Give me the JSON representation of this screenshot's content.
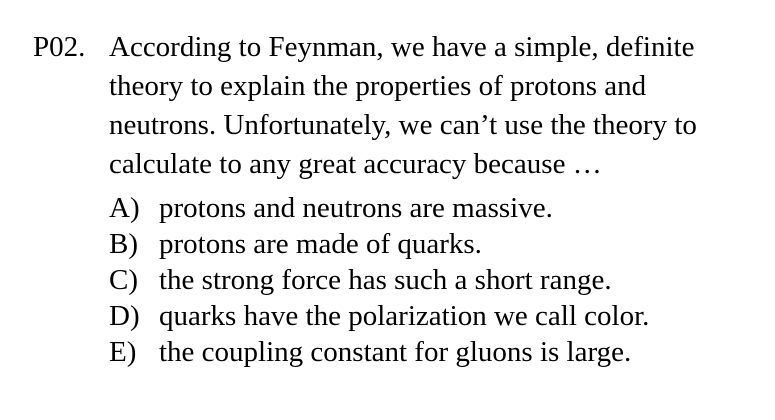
{
  "question": {
    "number": "P02.",
    "stem_lines": [
      "According to Feynman, we have a simple, definite",
      "theory to explain the properties of protons and",
      "neutrons.  Unfortunately, we can’t use the theory to",
      "calculate to any great accuracy because …"
    ],
    "choices": [
      {
        "letter": "A)",
        "text": "protons and neutrons are massive."
      },
      {
        "letter": "B)",
        "text": "protons are made of quarks."
      },
      {
        "letter": "C)",
        "text": "the strong force has such a short range."
      },
      {
        "letter": "D)",
        "text": "quarks have the polarization we call color."
      },
      {
        "letter": "E)",
        "text": "the coupling constant for gluons is large."
      }
    ]
  }
}
